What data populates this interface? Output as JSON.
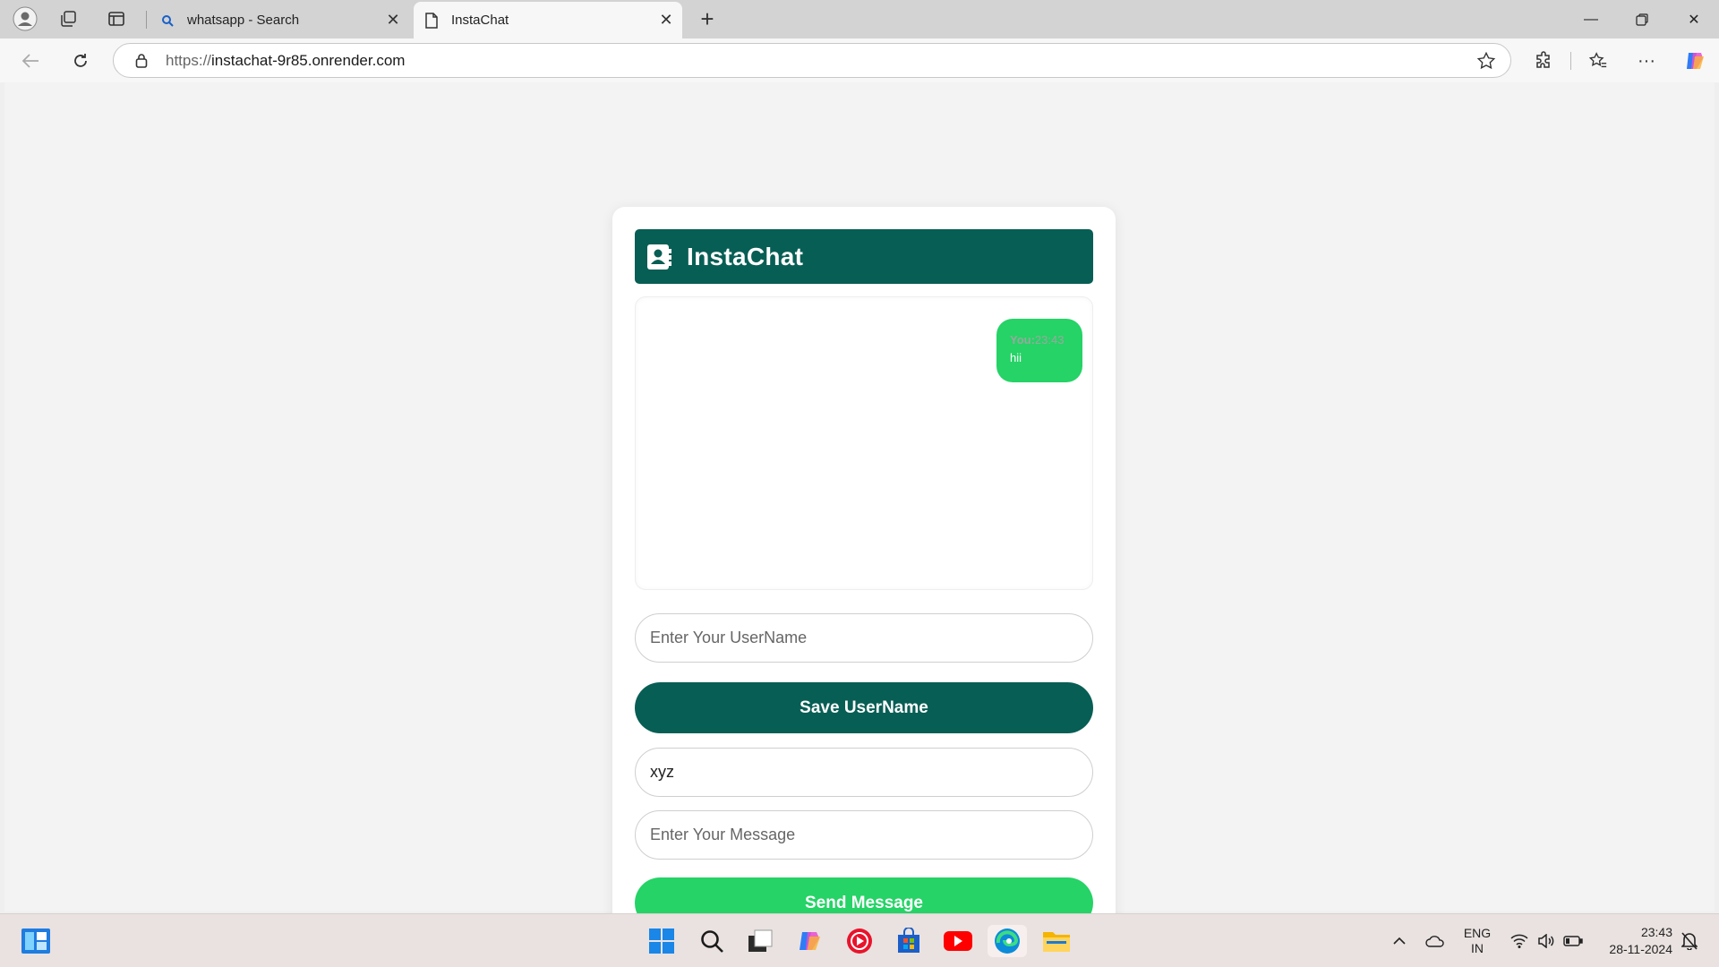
{
  "browser": {
    "tabs": [
      {
        "title": "whatsapp - Search",
        "icon": "search-icon",
        "active": false
      },
      {
        "title": "InstaChat",
        "icon": "page-icon",
        "active": true
      }
    ],
    "url_protocol": "https://",
    "url_host": "instachat-9r85.onrender.com"
  },
  "app": {
    "title": "InstaChat",
    "brand_color": "#075e54",
    "accent_color": "#25d366",
    "messages": [
      {
        "sender": "You:",
        "time": "23:43",
        "text": "hii"
      }
    ],
    "username_placeholder": "Enter Your UserName",
    "save_label": "Save UserName",
    "saved_username_value": "xyz",
    "message_placeholder": "Enter Your Message",
    "send_label": "Send Message"
  },
  "taskbar": {
    "lang_line1": "ENG",
    "lang_line2": "IN",
    "time": "23:43",
    "date": "28-11-2024"
  }
}
